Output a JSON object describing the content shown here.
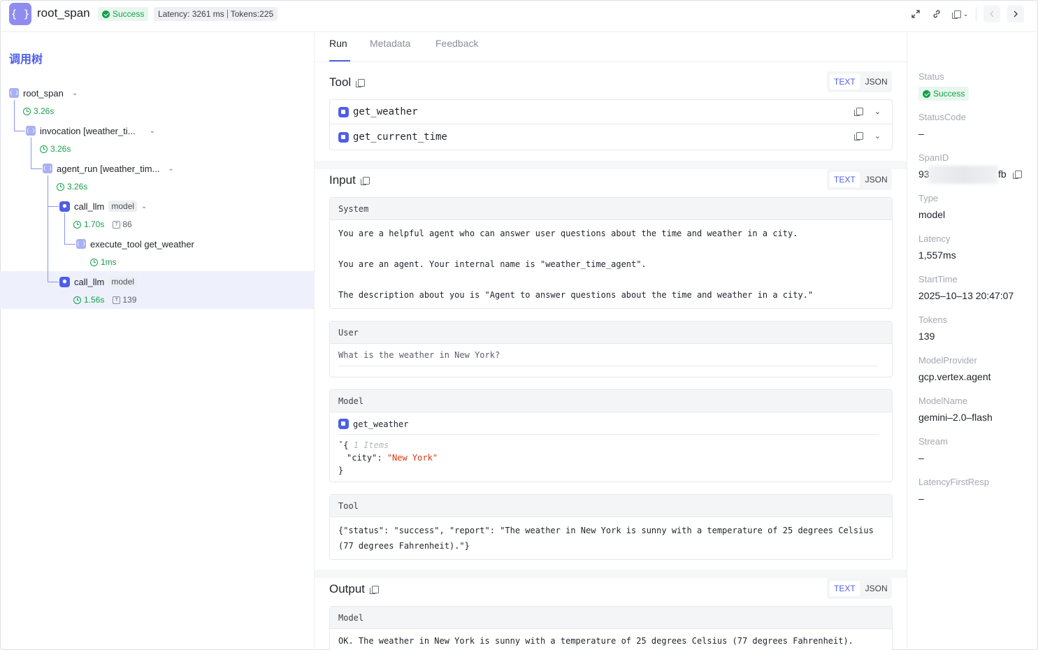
{
  "header": {
    "logo": "{ }",
    "title": "root_span",
    "status": "Success",
    "latency": "Latency: 3261 ms",
    "tokens": "Tokens:225"
  },
  "tree": {
    "title": "调用树",
    "nodes": [
      {
        "label": "root_span",
        "duration": "3.26s"
      },
      {
        "label": "invocation [weather_ti...",
        "duration": "3.26s"
      },
      {
        "label": "agent_run [weather_tim...",
        "duration": "3.26s"
      },
      {
        "label": "call_llm",
        "tag": "model",
        "duration": "1.70s",
        "tokens": "86"
      },
      {
        "label": "execute_tool get_weather",
        "duration": "1ms"
      },
      {
        "label": "call_llm",
        "tag": "model",
        "duration": "1.56s",
        "tokens": "139"
      }
    ]
  },
  "tabs": [
    "Run",
    "Metadata",
    "Feedback"
  ],
  "toggle": {
    "text": "TEXT",
    "json": "JSON"
  },
  "tool_section": {
    "title": "Tool",
    "items": [
      "get_weather",
      "get_current_time"
    ]
  },
  "input_section": {
    "title": "Input",
    "system": {
      "header": "System",
      "lines": [
        "You are a helpful agent who can answer user questions about the time and weather in a city.",
        "You are an agent. Your internal name is \"weather_time_agent\".",
        "The description about you is \"Agent to answer questions about the time and weather in a city.\""
      ]
    },
    "user": {
      "header": "User",
      "text": "What is the weather in New York?"
    },
    "model": {
      "header": "Model",
      "tool": "get_weather",
      "json_open": "{",
      "json_hint": "1 Items",
      "json_key": "\"city\"",
      "json_val": "\"New York\"",
      "json_close": "}"
    },
    "tool": {
      "header": "Tool",
      "line1": "{\"status\": \"success\", \"report\": \"The weather in New York is sunny with a temperature of 25 degrees Celsius",
      "line2": "(77 degrees Fahrenheit).\"}"
    }
  },
  "output_section": {
    "title": "Output",
    "model": {
      "header": "Model",
      "text": "OK. The weather in New York is sunny with a temperature of 25 degrees Celsius (77 degrees Fahrenheit)."
    }
  },
  "details": {
    "status_label": "Status",
    "status_value": "Success",
    "statuscode_label": "StatusCode",
    "statuscode_value": "–",
    "spanid_label": "SpanID",
    "spanid_start": "93",
    "spanid_end": "fb",
    "type_label": "Type",
    "type_value": "model",
    "latency_label": "Latency",
    "latency_value": "1,557ms",
    "starttime_label": "StartTime",
    "starttime_value": "2025–10–13 20:47:07",
    "tokens_label": "Tokens",
    "tokens_value": "139",
    "modelprovider_label": "ModelProvider",
    "modelprovider_value": "gcp.vertex.agent",
    "modelname_label": "ModelName",
    "modelname_value": "gemini–2.0–flash",
    "stream_label": "Stream",
    "stream_value": "–",
    "latencyfirst_label": "LatencyFirstResp",
    "latencyfirst_value": "–"
  }
}
